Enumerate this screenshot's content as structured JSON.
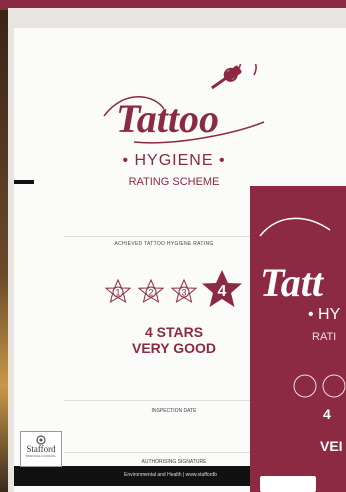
{
  "colors": {
    "brand": "#8c2a43",
    "card": "#fbfbfa",
    "footer": "#111111"
  },
  "front": {
    "logo_text": "Tattoo",
    "hygiene": "• HYGIENE •",
    "scheme": "RATING SCHEME",
    "achieved_label": "ACHIEVED TATTOO HYGIENE RATING",
    "star_numbers": [
      "1",
      "2",
      "3",
      "4"
    ],
    "rating_value": 4,
    "result_line1": "4 STARS",
    "result_line2": "VERY GOOD",
    "inspection_label": "INSPECTION DATE",
    "signature_label": "AUTHORISING SIGNATURE",
    "footer_text": "Environmental and Health | www.staffordb",
    "council_name": "Stafford",
    "council_sub": "BOROUGH COUNCIL"
  },
  "back": {
    "logo_text": "Tatt",
    "hygiene": "• HY",
    "scheme": "RATI",
    "result_line1": "4",
    "result_line2": "VEI"
  },
  "icons": [
    "tattoo-machine-icon",
    "star-icon",
    "stafford-crest-icon"
  ]
}
